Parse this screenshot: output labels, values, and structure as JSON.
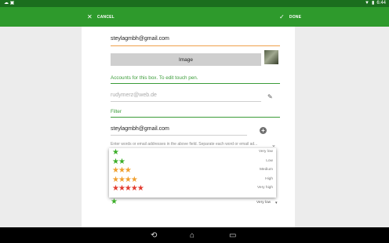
{
  "status_bar": {
    "time": "6:44"
  },
  "action_bar": {
    "cancel_label": "CANCEL",
    "done_label": "DONE"
  },
  "form": {
    "email_value": "steylagmbh@gmail.com",
    "image_button": "Image",
    "accounts_label": "Accounts for this box. To edit touch pen.",
    "account_value": "rudymerz@web.de",
    "filter_label": "Filter",
    "filter_value": "steylagmbh@gmail.com",
    "filter_hint": "Enter words or email addresses in the above field. Separate each word or email ad..."
  },
  "priority_dropdown": {
    "options": [
      {
        "stars": "★",
        "label": "Very low",
        "color": "#3cae29"
      },
      {
        "stars": "★★",
        "label": "Low",
        "color": "#3cae29"
      },
      {
        "stars": "★★★",
        "label": "Medium",
        "color": "#f0a030"
      },
      {
        "stars": "★★★★",
        "label": "High",
        "color": "#f0a030"
      },
      {
        "stars": "★★★★★",
        "label": "Very high",
        "color": "#e23b2e"
      }
    ],
    "selected_stars": "★",
    "selected_label": "Very low"
  },
  "colors": {
    "accent": "#2e9a2c",
    "status_bar": "#1b6e1e"
  }
}
